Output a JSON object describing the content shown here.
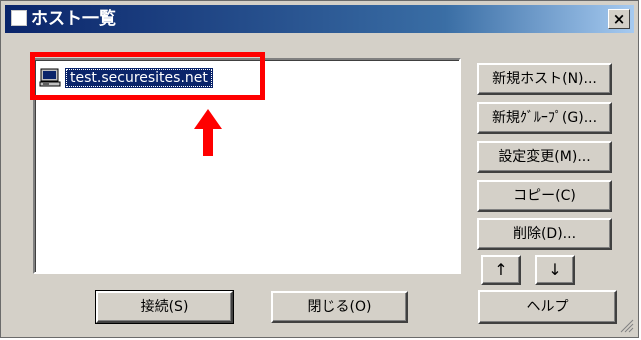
{
  "window": {
    "title": "ホスト一覧",
    "close_label": "×"
  },
  "hosts": [
    {
      "label": "test.securesites.net",
      "icon": "computer-icon"
    }
  ],
  "side_buttons": {
    "new_host": "新規ホスト(N)...",
    "new_group": "新規ｸﾞﾙｰﾌﾟ(G)...",
    "edit": "設定変更(M)...",
    "copy": "コピー(C)",
    "delete": "削除(D)...",
    "move_up": "↑",
    "move_down": "↓",
    "help": "ヘルプ"
  },
  "bottom_buttons": {
    "connect": "接続(S)",
    "close": "閉じる(O)"
  },
  "annotation": {
    "color": "#ff0000",
    "icon": "up-arrow-icon"
  },
  "colors": {
    "titlebar": "#0a246a",
    "selection": "#0a246a",
    "face": "#d4d0c8"
  }
}
